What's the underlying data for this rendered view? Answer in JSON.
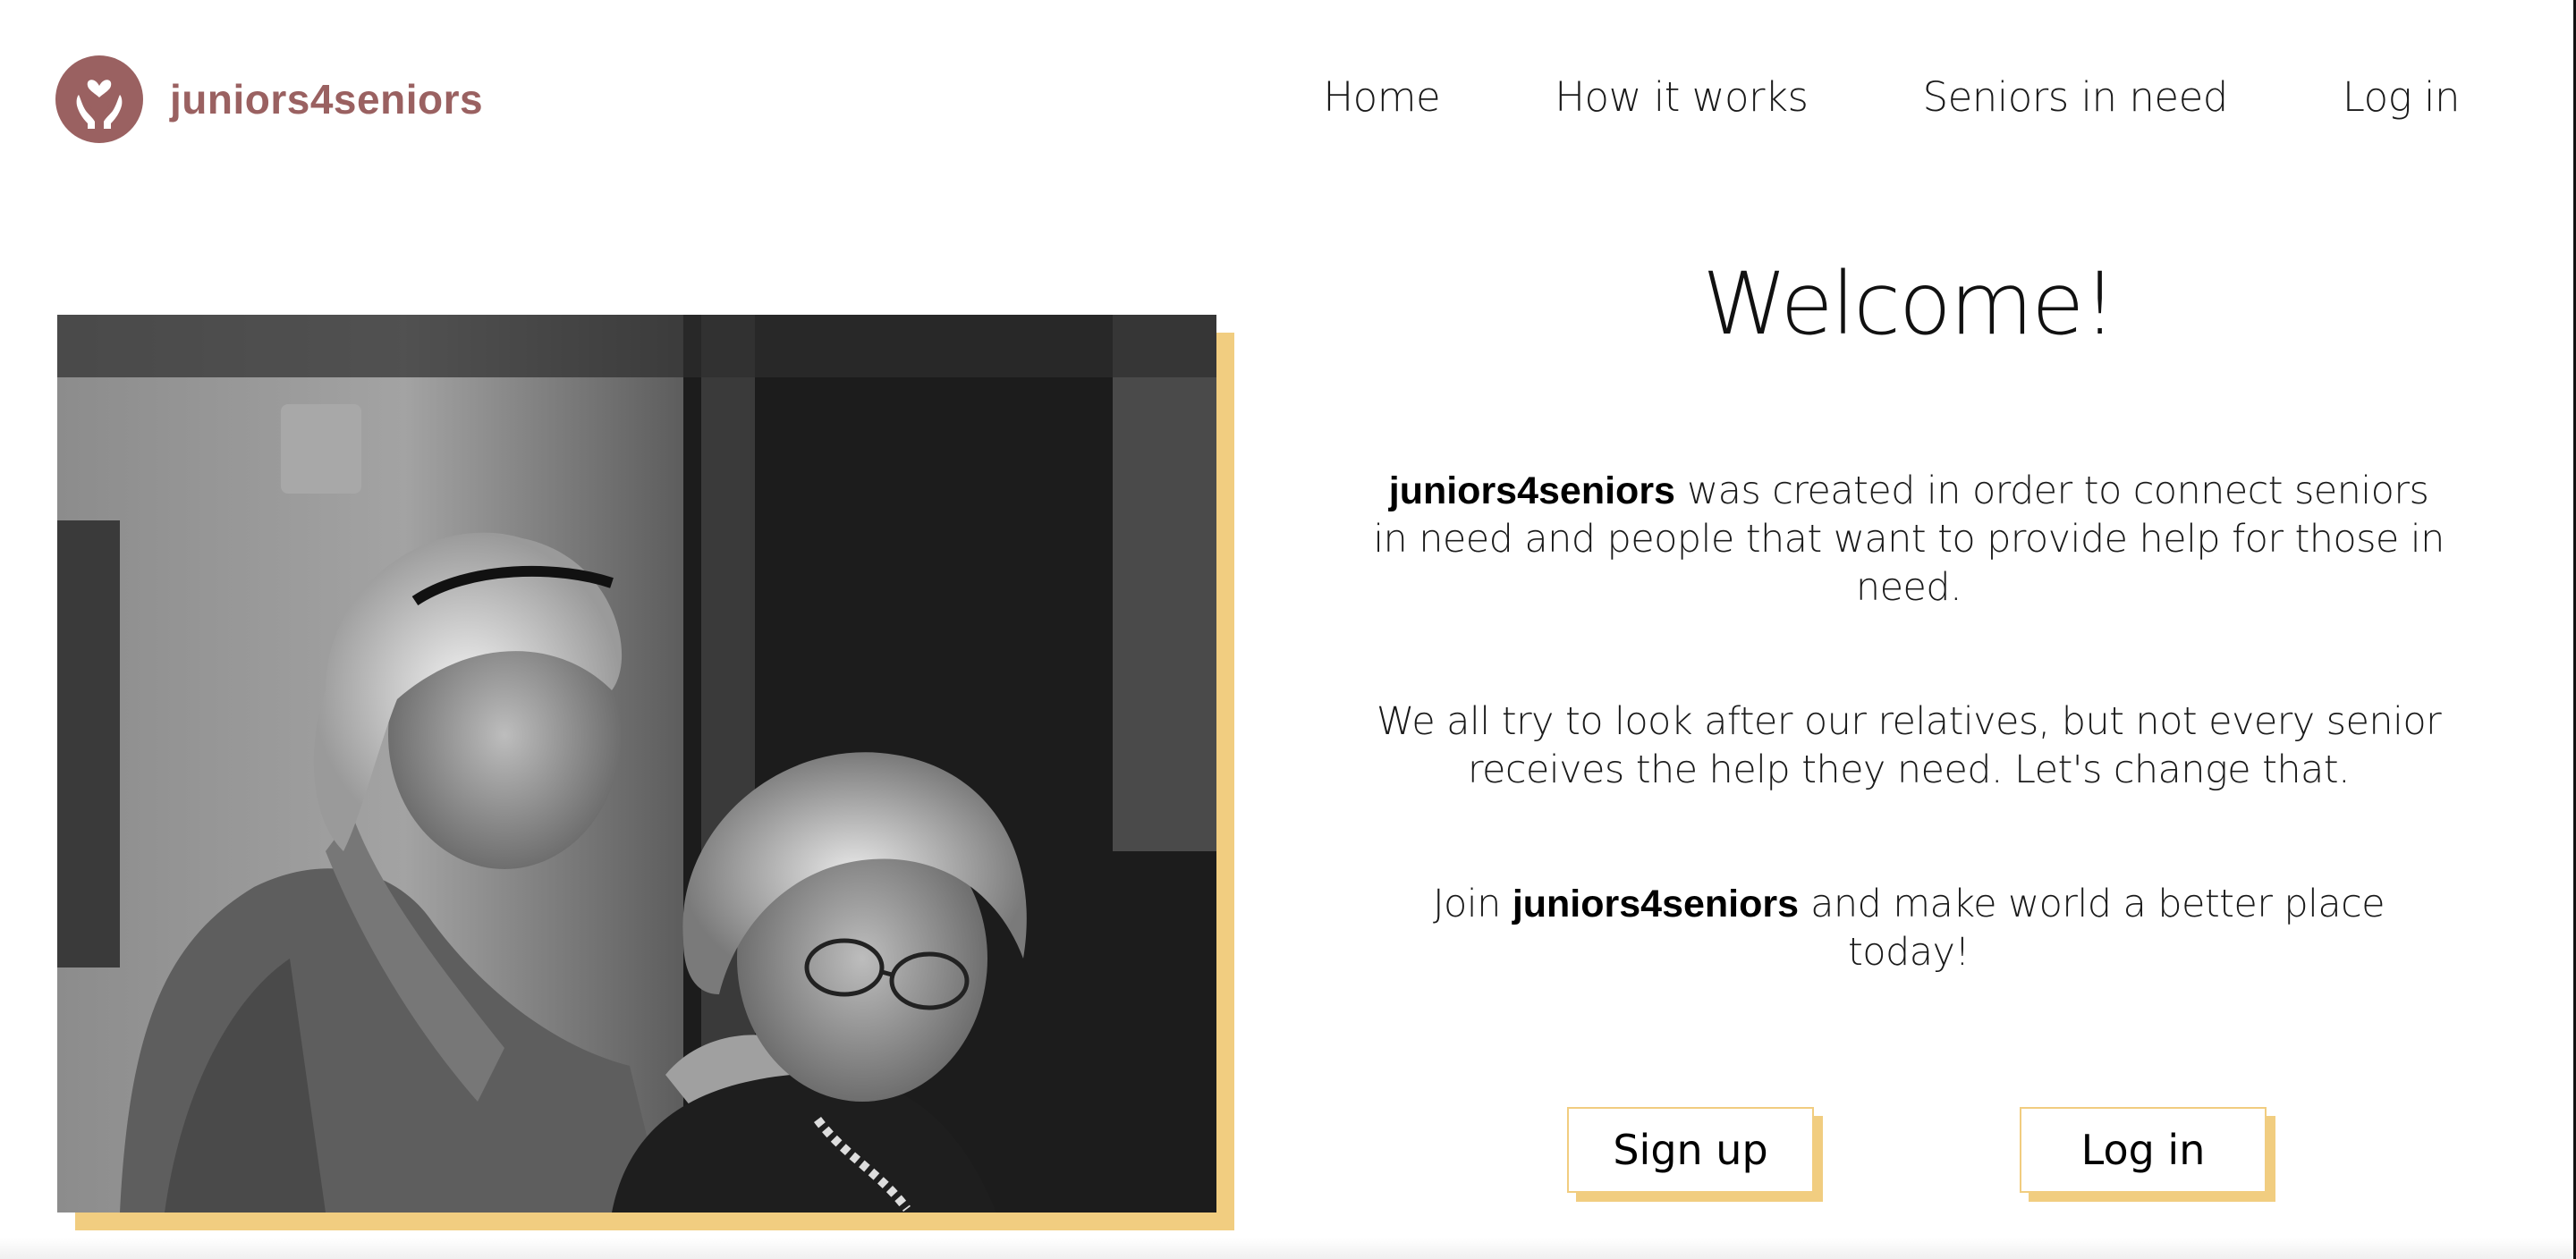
{
  "brand": {
    "name": "juniors4seniors",
    "color": "#9a6161"
  },
  "nav": {
    "items": [
      {
        "label": "Home"
      },
      {
        "label": "How it works"
      },
      {
        "label": "Seniors in need"
      },
      {
        "label": "Log in"
      }
    ]
  },
  "hero": {
    "image_icon": "photo-two-elderly-women",
    "accent_color": "#f1cd80"
  },
  "main": {
    "title": "Welcome!",
    "p1_brand": "juniors4seniors",
    "p1_text": " was created in order to connect seniors in need and people that want to provide help for those in need.",
    "p2_text": "We all try to look after our relatives, but not every senior receives the help they need. Let's change that.",
    "p3_pre": "Join ",
    "p3_brand": "juniors4seniors",
    "p3_post": " and make world a better place today!",
    "signup_label": "Sign up",
    "login_label": "Log in"
  }
}
